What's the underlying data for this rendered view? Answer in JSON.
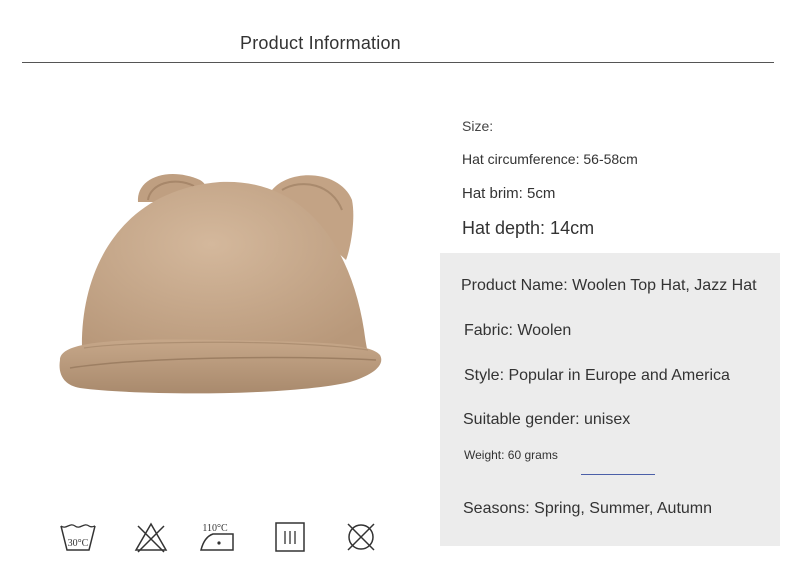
{
  "page": {
    "title": "Product Information"
  },
  "specs": {
    "size_label": "Size:",
    "circumference": "Hat circumference: 56-58cm",
    "brim": "Hat brim: 5cm",
    "depth": "Hat depth: 14cm"
  },
  "details": {
    "product_name": "Product Name: Woolen Top Hat, Jazz Hat",
    "fabric": "Fabric: Woolen",
    "style": "Style: Popular in Europe and America",
    "gender": "Suitable gender: unisex",
    "weight": "Weight: 60 grams",
    "seasons": "Seasons: Spring, Summer, Autumn"
  },
  "care_icons": {
    "wash_temp": "30°C",
    "iron_temp": "110°C"
  },
  "colors": {
    "hat": "#c9aa8c",
    "panel": "#ececec",
    "link_underline": "#4b5fa8"
  }
}
